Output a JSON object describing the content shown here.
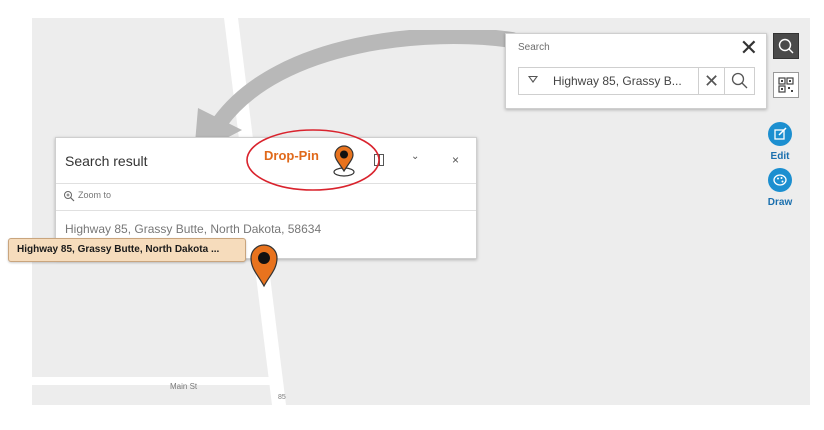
{
  "map": {
    "roads": {
      "main_st": "Main St",
      "route": "85"
    }
  },
  "search_panel": {
    "title": "Search",
    "input_value": "Highway 85, Grassy B...",
    "close_glyph": "✕",
    "clear_glyph": "✕",
    "icons": {
      "dropdown": "caret-down-icon",
      "search": "search-icon",
      "close": "close-icon",
      "clear": "clear-icon"
    }
  },
  "toolbar": {
    "search_icon": "search-icon",
    "qr_icon": "qr-code-icon",
    "edit_label": "Edit",
    "edit_icon": "edit-icon",
    "draw_label": "Draw",
    "draw_icon": "palette-icon"
  },
  "result_panel": {
    "title": "Search result",
    "zoom_label": "Zoom to",
    "address": "Highway 85, Grassy Butte, North Dakota, 58634",
    "chevron_glyph": "⌄",
    "close_glyph": "×",
    "icons": {
      "dock": "dock-panel-icon",
      "chevron": "chevron-down-icon",
      "close": "close-icon",
      "zoom": "zoom-in-icon"
    }
  },
  "annotation": {
    "drop_pin_label": "Drop-Pin",
    "label_color": "#e0691a",
    "ellipse_color": "#d9232d"
  },
  "map_marker": {
    "tag_text": "Highway 85, Grassy Butte, North Dakota ...",
    "pin_color": "#e8731e"
  },
  "colors": {
    "accent": "#1c8fd0",
    "map_background": "#ededed"
  }
}
